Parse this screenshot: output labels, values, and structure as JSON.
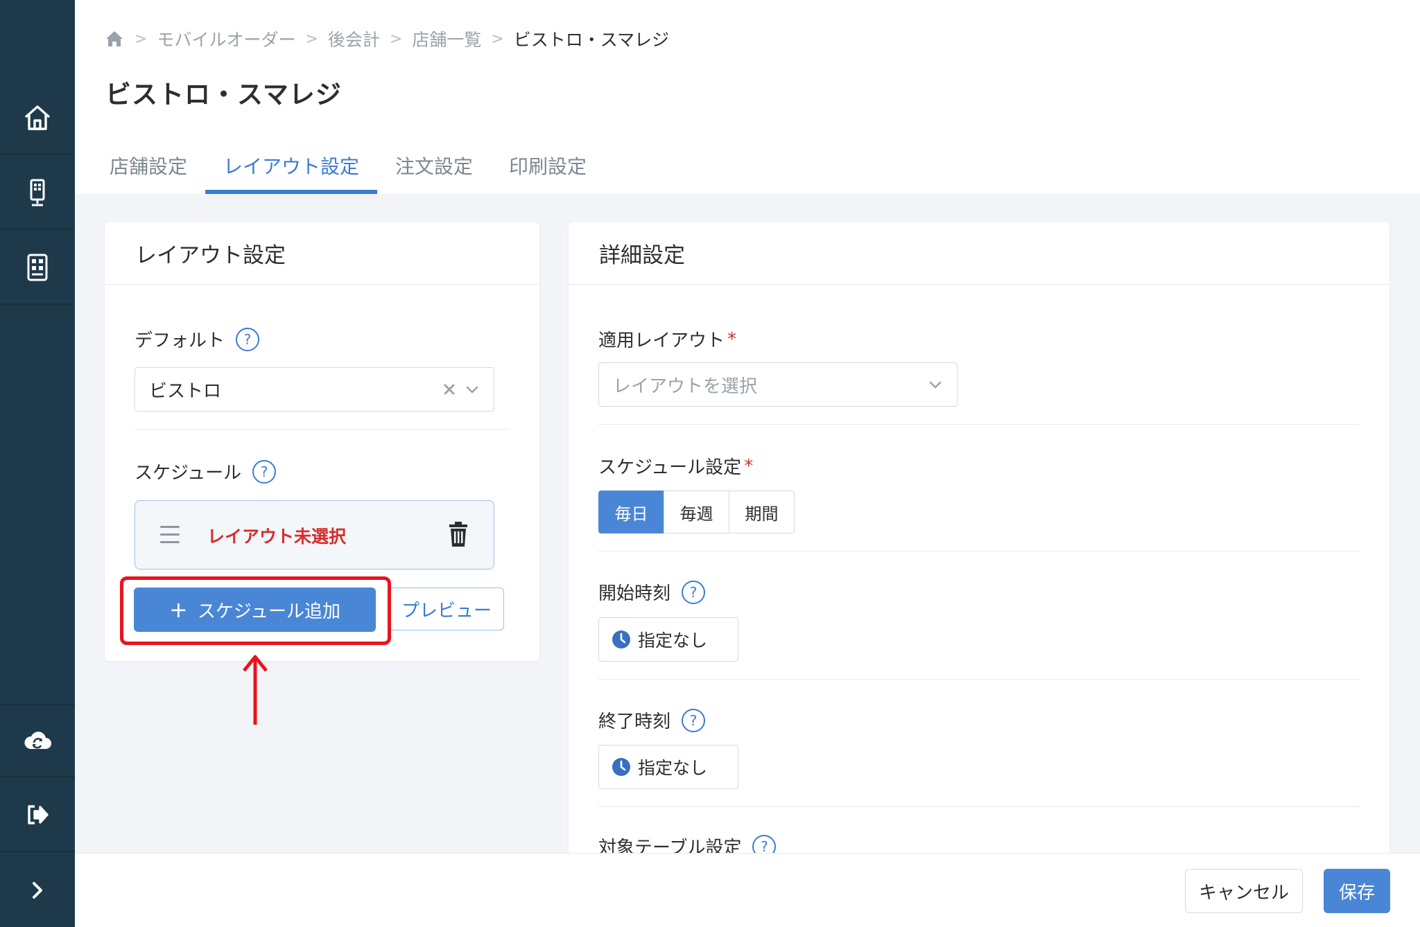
{
  "breadcrumb": [
    "モバイルオーダー",
    "後会計",
    "店舗一覧",
    "ビストロ・スマレジ"
  ],
  "page_title": "ビストロ・スマレジ",
  "tabs": [
    {
      "label": "店舗設定",
      "active": false
    },
    {
      "label": "レイアウト設定",
      "active": true
    },
    {
      "label": "注文設定",
      "active": false
    },
    {
      "label": "印刷設定",
      "active": false
    }
  ],
  "left_card": {
    "title": "レイアウト設定",
    "default_label": "デフォルト",
    "help": "?",
    "default_value": "ビストロ",
    "schedule_label": "スケジュール",
    "schedule_item": "レイアウト未選択",
    "add_schedule_button": "スケジュール追加",
    "preview_button": "プレビュー"
  },
  "right_card": {
    "title": "詳細設定",
    "apply_layout_label": "適用レイアウト",
    "required_mark": "*",
    "apply_layout_placeholder": "レイアウトを選択",
    "schedule_setting_label": "スケジュール設定",
    "schedule_options": [
      "毎日",
      "毎週",
      "期間"
    ],
    "schedule_selected": "毎日",
    "start_time_label": "開始時刻",
    "start_time_value": "指定なし",
    "end_time_label": "終了時刻",
    "end_time_value": "指定なし",
    "target_table_label": "対象テーブル設定"
  },
  "footer": {
    "cancel_button": "キャンセル",
    "save_button": "保存"
  },
  "colors": {
    "sidebar": "#1e3a4a",
    "accent": "#3a7bd5",
    "primary_button": "#4a86d6",
    "error": "#d92b2b",
    "highlight": "#e8141c"
  }
}
